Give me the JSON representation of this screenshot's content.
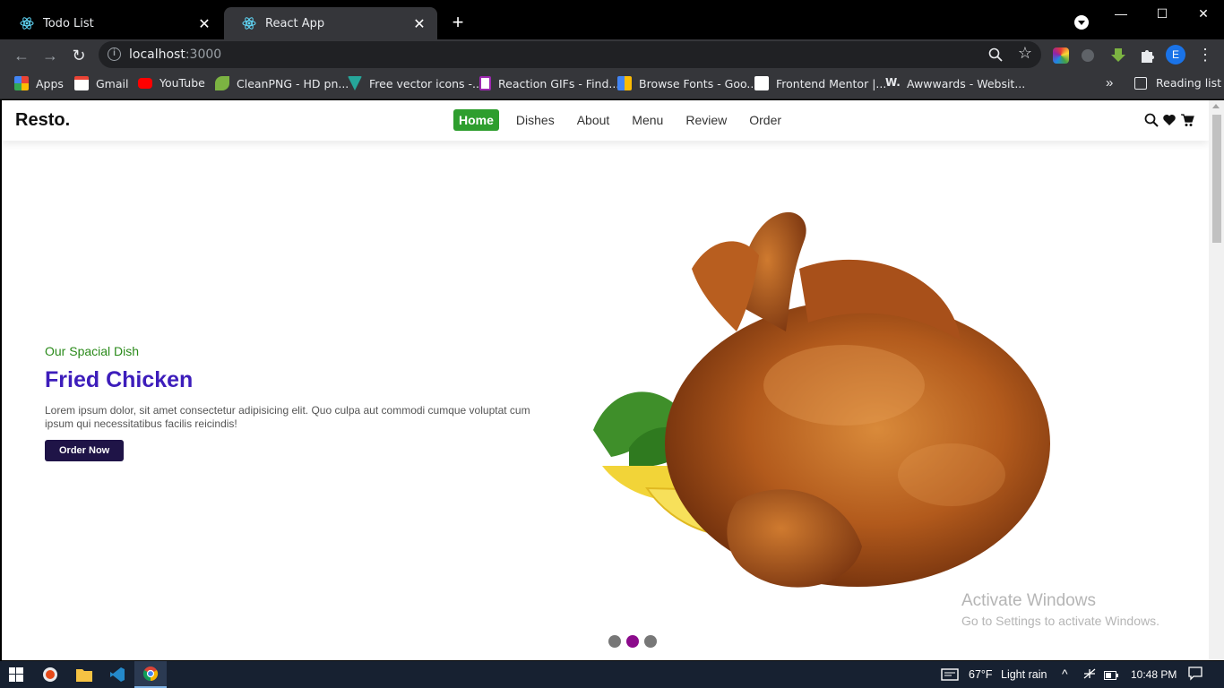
{
  "browser": {
    "tabs": [
      {
        "title": "Todo List",
        "active": false
      },
      {
        "title": "React App",
        "active": true
      }
    ],
    "url_host": "localhost",
    "url_port": ":3000",
    "profile_initial": "E",
    "bookmarks": [
      {
        "label": "Apps",
        "icon": "apps-grid-icon"
      },
      {
        "label": "Gmail",
        "icon": "gmail-icon"
      },
      {
        "label": "YouTube",
        "icon": "youtube-icon"
      },
      {
        "label": "CleanPNG - HD pn...",
        "icon": "cleanpng-icon"
      },
      {
        "label": "Free vector icons -...",
        "icon": "vector-icons-icon"
      },
      {
        "label": "Reaction GIFs - Find...",
        "icon": "reaction-gifs-icon"
      },
      {
        "label": "Browse Fonts - Goo...",
        "icon": "google-fonts-icon"
      },
      {
        "label": "Frontend Mentor |...",
        "icon": "frontend-mentor-icon"
      },
      {
        "label": "Awwwards - Websit...",
        "icon": "awwwards-icon"
      }
    ],
    "reading_list": "Reading list",
    "more_bookmarks": "»"
  },
  "page": {
    "logo": "Resto.",
    "nav": [
      {
        "label": "Home",
        "active": true
      },
      {
        "label": "Dishes",
        "active": false
      },
      {
        "label": "About",
        "active": false
      },
      {
        "label": "Menu",
        "active": false
      },
      {
        "label": "Review",
        "active": false
      },
      {
        "label": "Order",
        "active": false
      }
    ],
    "header_icons": [
      "search-icon",
      "heart-icon",
      "cart-icon"
    ],
    "hero": {
      "subtitle": "Our Spacial Dish",
      "title": "Fried Chicken",
      "description": "Lorem ipsum dolor, sit amet consectetur adipisicing elit.  Quo culpa aut commodi cumque voluptat cum ipsum qui necessitatibus facilis reicindis!",
      "button": "Order Now"
    },
    "slider_dots": 3,
    "active_dot": 1,
    "colors": {
      "nav_active": "#2e9e2e",
      "subtitle": "#2a8a1a",
      "title": "#3d1dbb",
      "button": "#1f1447",
      "active_dot": "#8b0a8b"
    }
  },
  "windows": {
    "activation_title": "Activate Windows",
    "activation_sub": "Go to Settings to activate Windows.",
    "weather_temp": "67°F",
    "weather_desc": "Light rain",
    "time": "10:48 PM"
  }
}
